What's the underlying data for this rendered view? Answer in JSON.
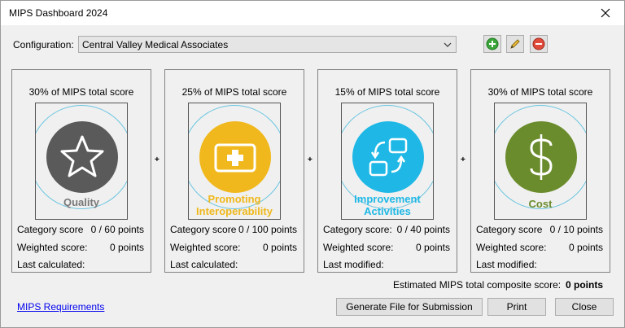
{
  "window": {
    "title": "MIPS Dashboard 2024"
  },
  "config": {
    "label": "Configuration:",
    "selected": "Central Valley Medical Associates",
    "icons": [
      "add-icon",
      "edit-pencil-icon",
      "remove-icon"
    ]
  },
  "colors": {
    "quality": "#5a5a5a",
    "interop": "#f0b81c",
    "improvement": "#1fb8e6",
    "cost": "#6a8c2c"
  },
  "cards": [
    {
      "pct": "30% of MIPS total score",
      "category_line1": "Quality",
      "category_line2": "",
      "icon": "star-icon",
      "row1_label": "Category score",
      "row1_value": "0 / 60 points",
      "row2_label": "Weighted score:",
      "row2_value": "0 points",
      "row3_label": "Last calculated:"
    },
    {
      "pct": "25% of MIPS total score",
      "category_line1": "Promoting",
      "category_line2": "Interoperability",
      "icon": "medical-cross-icon",
      "row1_label": "Category score",
      "row1_value": "0 / 100 points",
      "row2_label": "Weighted score:",
      "row2_value": "0 points",
      "row3_label": "Last calculated:"
    },
    {
      "pct": "15% of MIPS total score",
      "category_line1": "Improvement",
      "category_line2": "Activities",
      "icon": "exchange-arrows-icon",
      "row1_label": "Category score:",
      "row1_value": "0 / 40 points",
      "row2_label": "Weighted score:",
      "row2_value": "0 points",
      "row3_label": "Last modified:"
    },
    {
      "pct": "30% of MIPS total score",
      "category_line1": "Cost",
      "category_line2": "",
      "icon": "dollar-icon",
      "row1_label": "Category score",
      "row1_value": "0 / 10 points",
      "row2_label": "Weighted score:",
      "row2_value": "0 points",
      "row3_label": "Last modified:"
    }
  ],
  "plus_sign": "+",
  "estimate": {
    "label": "Estimated MIPS total composite score:",
    "value": "0 points"
  },
  "footer": {
    "link": "MIPS Requirements",
    "generate": "Generate File for Submission",
    "print": "Print",
    "close": "Close"
  }
}
